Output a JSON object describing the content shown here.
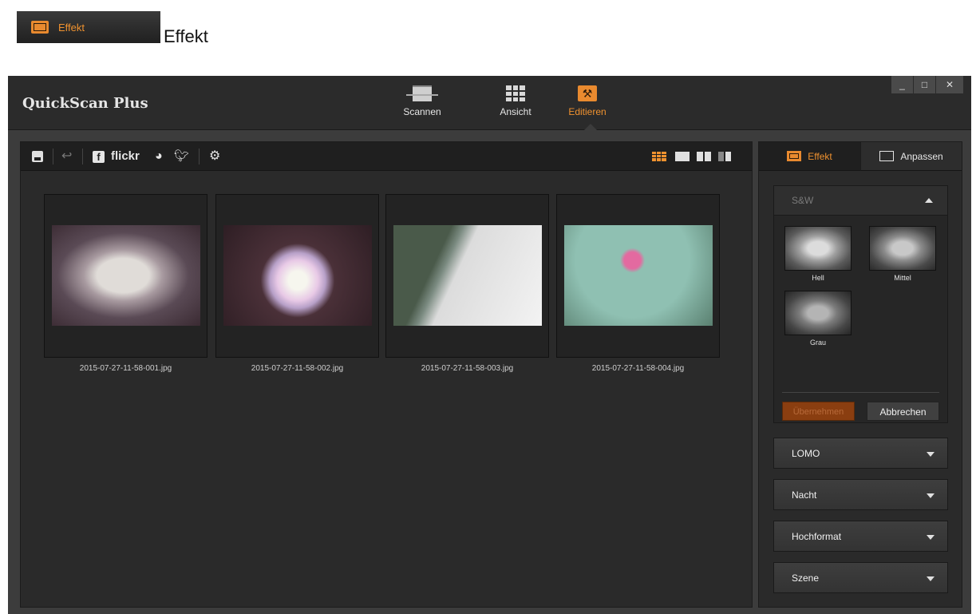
{
  "caption": {
    "badge_label": "Effekt",
    "text": "Effekt"
  },
  "app": {
    "title": "QuickScan Plus",
    "nav": [
      {
        "label": "Scannen",
        "icon": "scanner-icon"
      },
      {
        "label": "Ansicht",
        "icon": "grid-view-icon"
      },
      {
        "label": "Editieren",
        "icon": "edit-tools-icon",
        "active": true
      }
    ],
    "window_controls": [
      "_",
      "□",
      "✕"
    ]
  },
  "toolbar": {
    "flickr_label": "flickr",
    "icons": [
      "save-icon",
      "undo-icon",
      "facebook-icon",
      "flickr-icon",
      "cloud-icon",
      "twitter-icon",
      "settings-icon",
      "grid-view-icon",
      "single-view-icon",
      "double-view-icon",
      "compare-view-icon"
    ]
  },
  "thumbnails": [
    {
      "filename": "2015-07-27-11-58-001.jpg"
    },
    {
      "filename": "2015-07-27-11-58-002.jpg"
    },
    {
      "filename": "2015-07-27-11-58-003.jpg"
    },
    {
      "filename": "2015-07-27-11-58-004.jpg"
    }
  ],
  "side": {
    "tabs": [
      {
        "label": "Effekt",
        "active": true
      },
      {
        "label": "Anpassen"
      }
    ],
    "sw": {
      "title": "S&W",
      "presets": [
        {
          "label": "Hell"
        },
        {
          "label": "Mittel"
        },
        {
          "label": "Grau"
        }
      ],
      "apply_label": "Übernehmen",
      "cancel_label": "Abbrechen"
    },
    "accordions": [
      {
        "label": "LOMO"
      },
      {
        "label": "Nacht"
      },
      {
        "label": "Hochformat"
      },
      {
        "label": "Szene"
      }
    ]
  },
  "colors": {
    "accent": "#f0922f",
    "background": "#3c3c3c",
    "panel": "#2a2a2a"
  }
}
